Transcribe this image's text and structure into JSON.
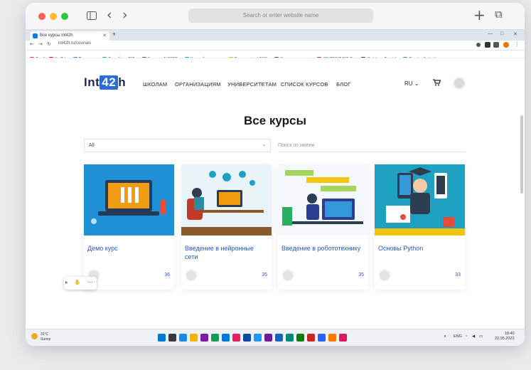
{
  "safari": {
    "address_placeholder": "Search or enter website name",
    "sidebar_icon": "sidebar-icon",
    "back_icon": "‹",
    "forward_icon": "›",
    "new_tab_icon": "+",
    "tabs_overview_icon": "⧉"
  },
  "chrome": {
    "tab_title": "Все курсы Int42h",
    "new_tab": "+",
    "url": "int42h.ru/courses",
    "bookmarks": [
      {
        "label": "Gmail",
        "color": "#ea4335"
      },
      {
        "label": "YouTube",
        "color": "#ff0000"
      },
      {
        "label": "Переводчик",
        "color": "#4285f4"
      },
      {
        "label": "Разработка ВКБ...",
        "color": "#34a853"
      },
      {
        "label": "Главная: ALFORB...",
        "color": "#2e7d32"
      },
      {
        "label": "Кодовабеспечение...",
        "color": "#03a9f4"
      },
      {
        "label": "Programming LINKS...",
        "color": "#fbbc05"
      },
      {
        "label": "Интернет-магазин...",
        "color": "#1565c0"
      },
      {
        "label": "КОНТРАКТ ВКБ Ро...",
        "color": "#d32f2f"
      },
      {
        "label": "Markdown Tutorial...",
        "color": "#6a1b9a"
      },
      {
        "label": "Creating Android...",
        "color": "#43a047"
      }
    ]
  },
  "site": {
    "logo_pre": "Int",
    "logo_box": "42",
    "logo_post": "h",
    "nav": [
      "ШКОЛАМ",
      "ОРГАНИЗАЦИЯМ",
      "УНИВЕРСИТЕТАМ",
      "СПИСОК КУРСОВ",
      "БЛОГ"
    ],
    "lang": "RU",
    "lang_chevron": "⌄",
    "cart_icon": "cart-icon",
    "page_title": "Все курсы",
    "filter_value": "All",
    "filter_chevron": "⌄",
    "search_placeholder": "Поиск по имени",
    "courses": [
      {
        "title": "Демо курс",
        "count": "36",
        "bg": "#1f8fd6",
        "accent": "#f39c12"
      },
      {
        "title": "Введение в нейронные сети",
        "count": "35",
        "bg": "#e8f4f8",
        "accent": "#c0392b"
      },
      {
        "title": "Введение в робототехнику",
        "count": "35",
        "bg": "#f4f7fb",
        "accent": "#2c3e90"
      },
      {
        "title": "Основы Python",
        "count": "33",
        "bg": "#1fa1c2",
        "accent": "#f1c40f"
      }
    ]
  },
  "floatbar": {
    "text": "⏸ ✋ ⋯"
  },
  "taskbar": {
    "weather_temp": "31°C",
    "weather_desc": "Sunny",
    "tray_lang": "ENG",
    "time": "10:40",
    "date": "22.05.2023",
    "apps": [
      "#0078d4",
      "#3a3a3a",
      "#1e88e5",
      "#f4b400",
      "#7b1fa2",
      "#0f9d58",
      "#0078d4",
      "#e91e63",
      "#0d47a1",
      "#2196f3",
      "#6a1b9a",
      "#1565c0",
      "#00897b",
      "#107c10",
      "#c62828",
      "#2962ff",
      "#f57c00",
      "#d81b60"
    ]
  }
}
